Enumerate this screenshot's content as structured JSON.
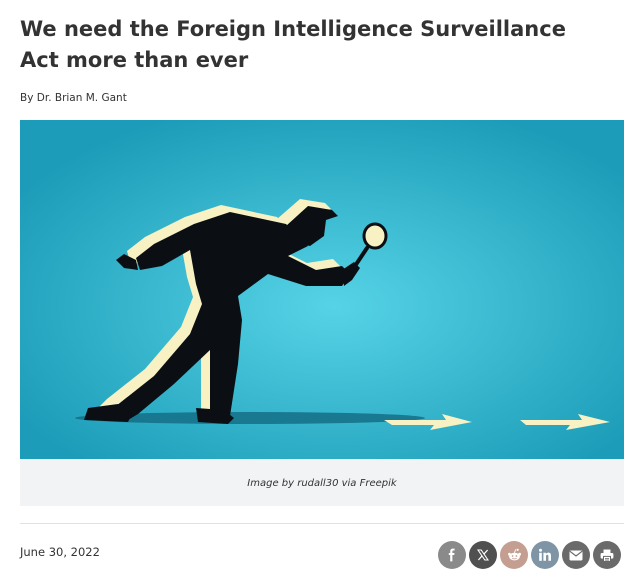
{
  "article": {
    "title": "We need the Foreign Intelligence Surveillance Act more than ever",
    "byline": "By Dr. Brian M. Gant",
    "image_caption": "Image by rudall30 via Freepik",
    "date": "June 30, 2022"
  },
  "share_buttons": [
    {
      "icon": "facebook-icon",
      "color": "#8a8a8a"
    },
    {
      "icon": "x-icon",
      "color": "#505050"
    },
    {
      "icon": "reddit-icon",
      "color": "#c39e91"
    },
    {
      "icon": "linkedin-icon",
      "color": "#7f95a5"
    },
    {
      "icon": "email-icon",
      "color": "#6a6a6a"
    },
    {
      "icon": "print-icon",
      "color": "#6a6a6a"
    }
  ],
  "colors": {
    "illustration_bg": "#22a3bd",
    "illustration_glow": "#56d3e6",
    "arrow": "#f7f1c4"
  }
}
